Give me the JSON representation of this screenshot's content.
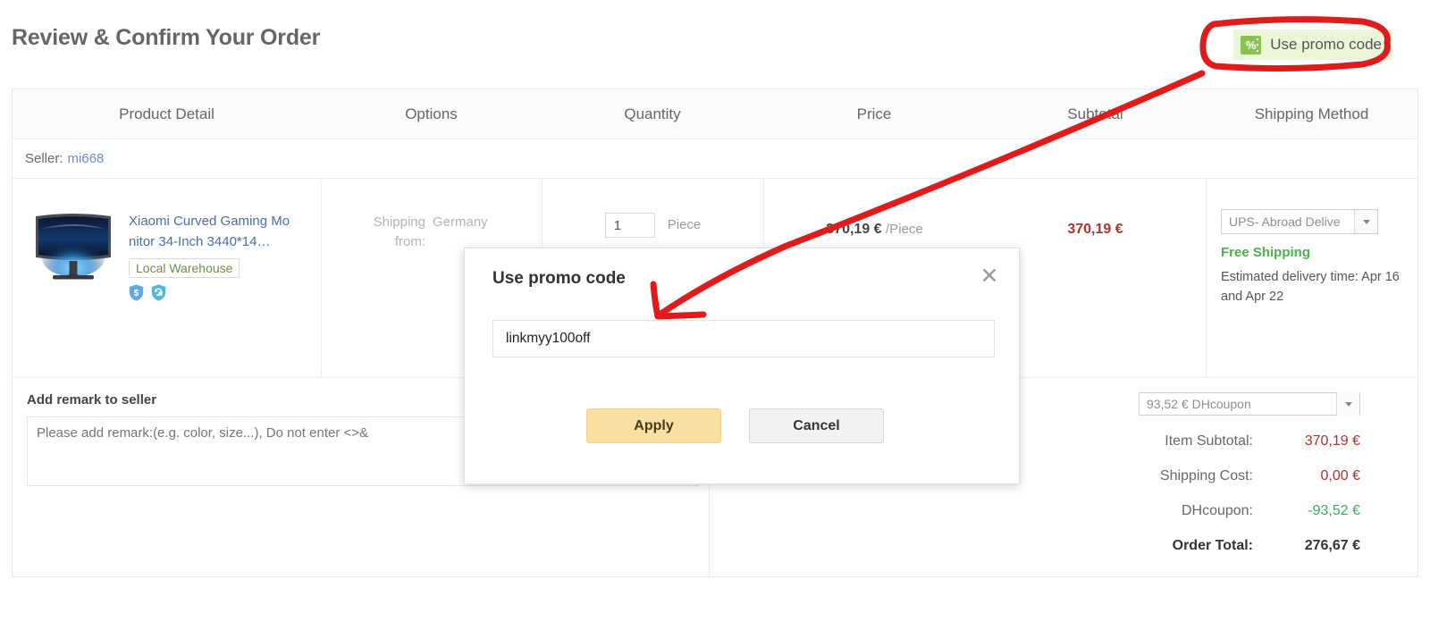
{
  "header": {
    "title": "Review & Confirm Your Order",
    "promo_button_label": "Use promo code",
    "promo_icon": "percent-coupon-icon"
  },
  "table": {
    "columns": [
      "Product Detail",
      "Options",
      "Quantity",
      "Price",
      "Subtotal",
      "Shipping Method"
    ],
    "seller_label": "Seller:",
    "seller_name": "mi668"
  },
  "item": {
    "title": "Xiaomi Curved Gaming Monitor 34-Inch 3440*14…",
    "warehouse_badge": "Local Warehouse",
    "badges": [
      "money-back-shield-icon",
      "return-policy-shield-icon"
    ],
    "shipping_from_label": "Shipping from:",
    "shipping_from_value": "Germany",
    "quantity": "1",
    "quantity_unit": "Piece",
    "unit_price": "370,19 €",
    "unit_price_suffix": "/Piece",
    "subtotal": "370,19 €",
    "shipping_method": "UPS- Abroad Delive",
    "free_shipping": "Free Shipping",
    "eta": "Estimated delivery time: Apr 16 and Apr 22"
  },
  "remark": {
    "title": "Add remark to seller",
    "placeholder": "Please add remark:(e.g. color, size...), Do not enter <>&",
    "value": ""
  },
  "summary": {
    "coupon_select": "93,52 € DHcoupon",
    "lines": [
      {
        "label": "Item Subtotal:",
        "value": "370,19 €",
        "style": "red"
      },
      {
        "label": "Shipping Cost:",
        "value": "0,00 €",
        "style": "red"
      },
      {
        "label": "DHcoupon:",
        "value": "-93,52 €",
        "style": "green"
      },
      {
        "label": "Order Total:",
        "value": "276,67 €",
        "style": "red-bold"
      }
    ]
  },
  "modal": {
    "title": "Use promo code",
    "close_icon": "close-icon",
    "input_value": "linkmyy100off",
    "input_placeholder": "",
    "apply_label": "Apply",
    "cancel_label": "Cancel"
  },
  "annotation": {
    "color": "#e01b1b",
    "shapes": "highlight-rectangle-and-arrow"
  },
  "colors": {
    "promo_bg": "#eaf6d7",
    "promo_icon": "#8cc153",
    "price_red": "#b03030",
    "coupon_green": "#3faa63",
    "free_shipping_green": "#4caf50",
    "apply_button": "#fadfa3",
    "link_blue": "#4a6ea9",
    "annotation_red": "#e01b1b"
  }
}
